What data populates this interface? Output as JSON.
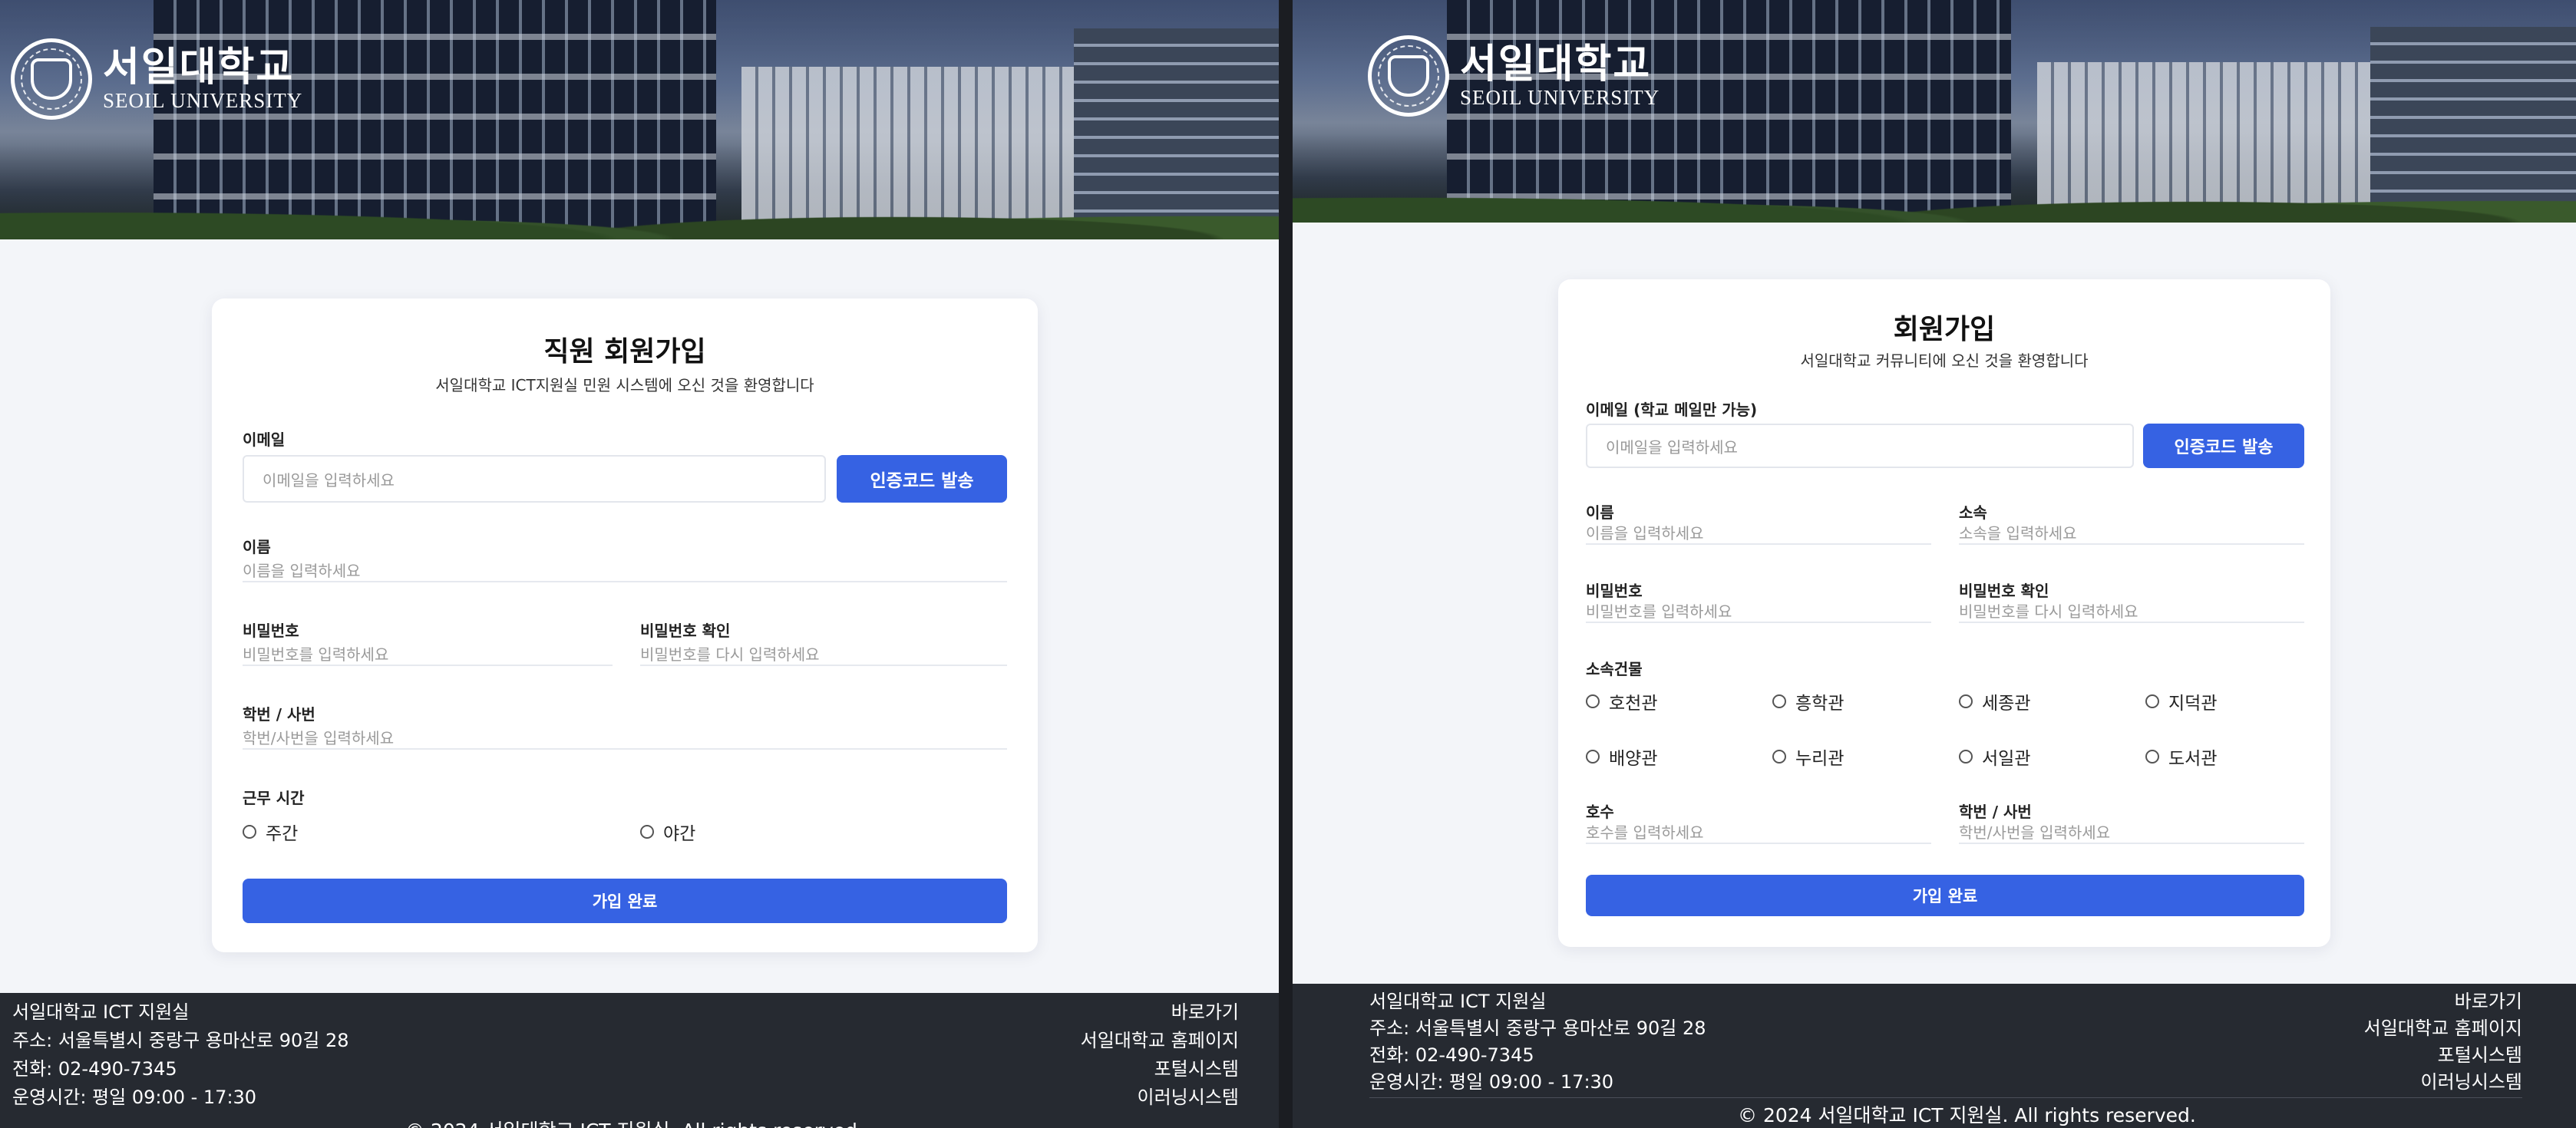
{
  "brand": {
    "name_ko": "서일대학교",
    "name_en": "SEOIL UNIVERSITY",
    "seal_text": "서일대"
  },
  "left": {
    "title": "직원 회원가입",
    "subtitle": "서일대학교 ICT지원실 민원 시스템에 오신 것을 환영합니다",
    "email_label": "이메일",
    "email_placeholder": "이메일을 입력하세요",
    "send_code": "인증코드 발송",
    "name_label": "이름",
    "name_placeholder": "이름을 입력하세요",
    "pw_label": "비밀번호",
    "pw_placeholder": "비밀번호를 입력하세요",
    "pw2_label": "비밀번호 확인",
    "pw2_placeholder": "비밀번호를 다시 입력하세요",
    "id_label": "학번 / 사번",
    "id_placeholder": "학번/사번을 입력하세요",
    "shift_label": "근무 시간",
    "shift_options": [
      "주간",
      "야간"
    ],
    "submit": "가입 완료"
  },
  "right": {
    "title": "회원가입",
    "subtitle": "서일대학교 커뮤니티에 오신 것을 환영합니다",
    "email_label": "이메일 (학교 메일만 가능)",
    "email_placeholder": "이메일을 입력하세요",
    "send_code": "인증코드 발송",
    "name_label": "이름",
    "name_placeholder": "이름을 입력하세요",
    "dept_label": "소속",
    "dept_placeholder": "소속을 입력하세요",
    "pw_label": "비밀번호",
    "pw_placeholder": "비밀번호를 입력하세요",
    "pw2_label": "비밀번호 확인",
    "pw2_placeholder": "비밀번호를 다시 입력하세요",
    "building_label": "소속건물",
    "buildings": [
      "호천관",
      "흥학관",
      "세종관",
      "지덕관",
      "배양관",
      "누리관",
      "서일관",
      "도서관"
    ],
    "room_label": "호수",
    "room_placeholder": "호수를 입력하세요",
    "id_label": "학번 / 사번",
    "id_placeholder": "학번/사번을 입력하세요",
    "submit": "가입 완료"
  },
  "footer": {
    "org": "서일대학교 ICT 지원실",
    "address": "주소: 서울특별시 중랑구 용마산로 90길 28",
    "phone": "전화: 02-490-7345",
    "hours": "운영시간: 평일 09:00 - 17:30",
    "links_title": "바로가기",
    "links": [
      "서일대학교 홈페이지",
      "포털시스템",
      "이러닝시스템"
    ],
    "copyright": "© 2024 서일대학교 ICT 지원실. All rights reserved."
  }
}
